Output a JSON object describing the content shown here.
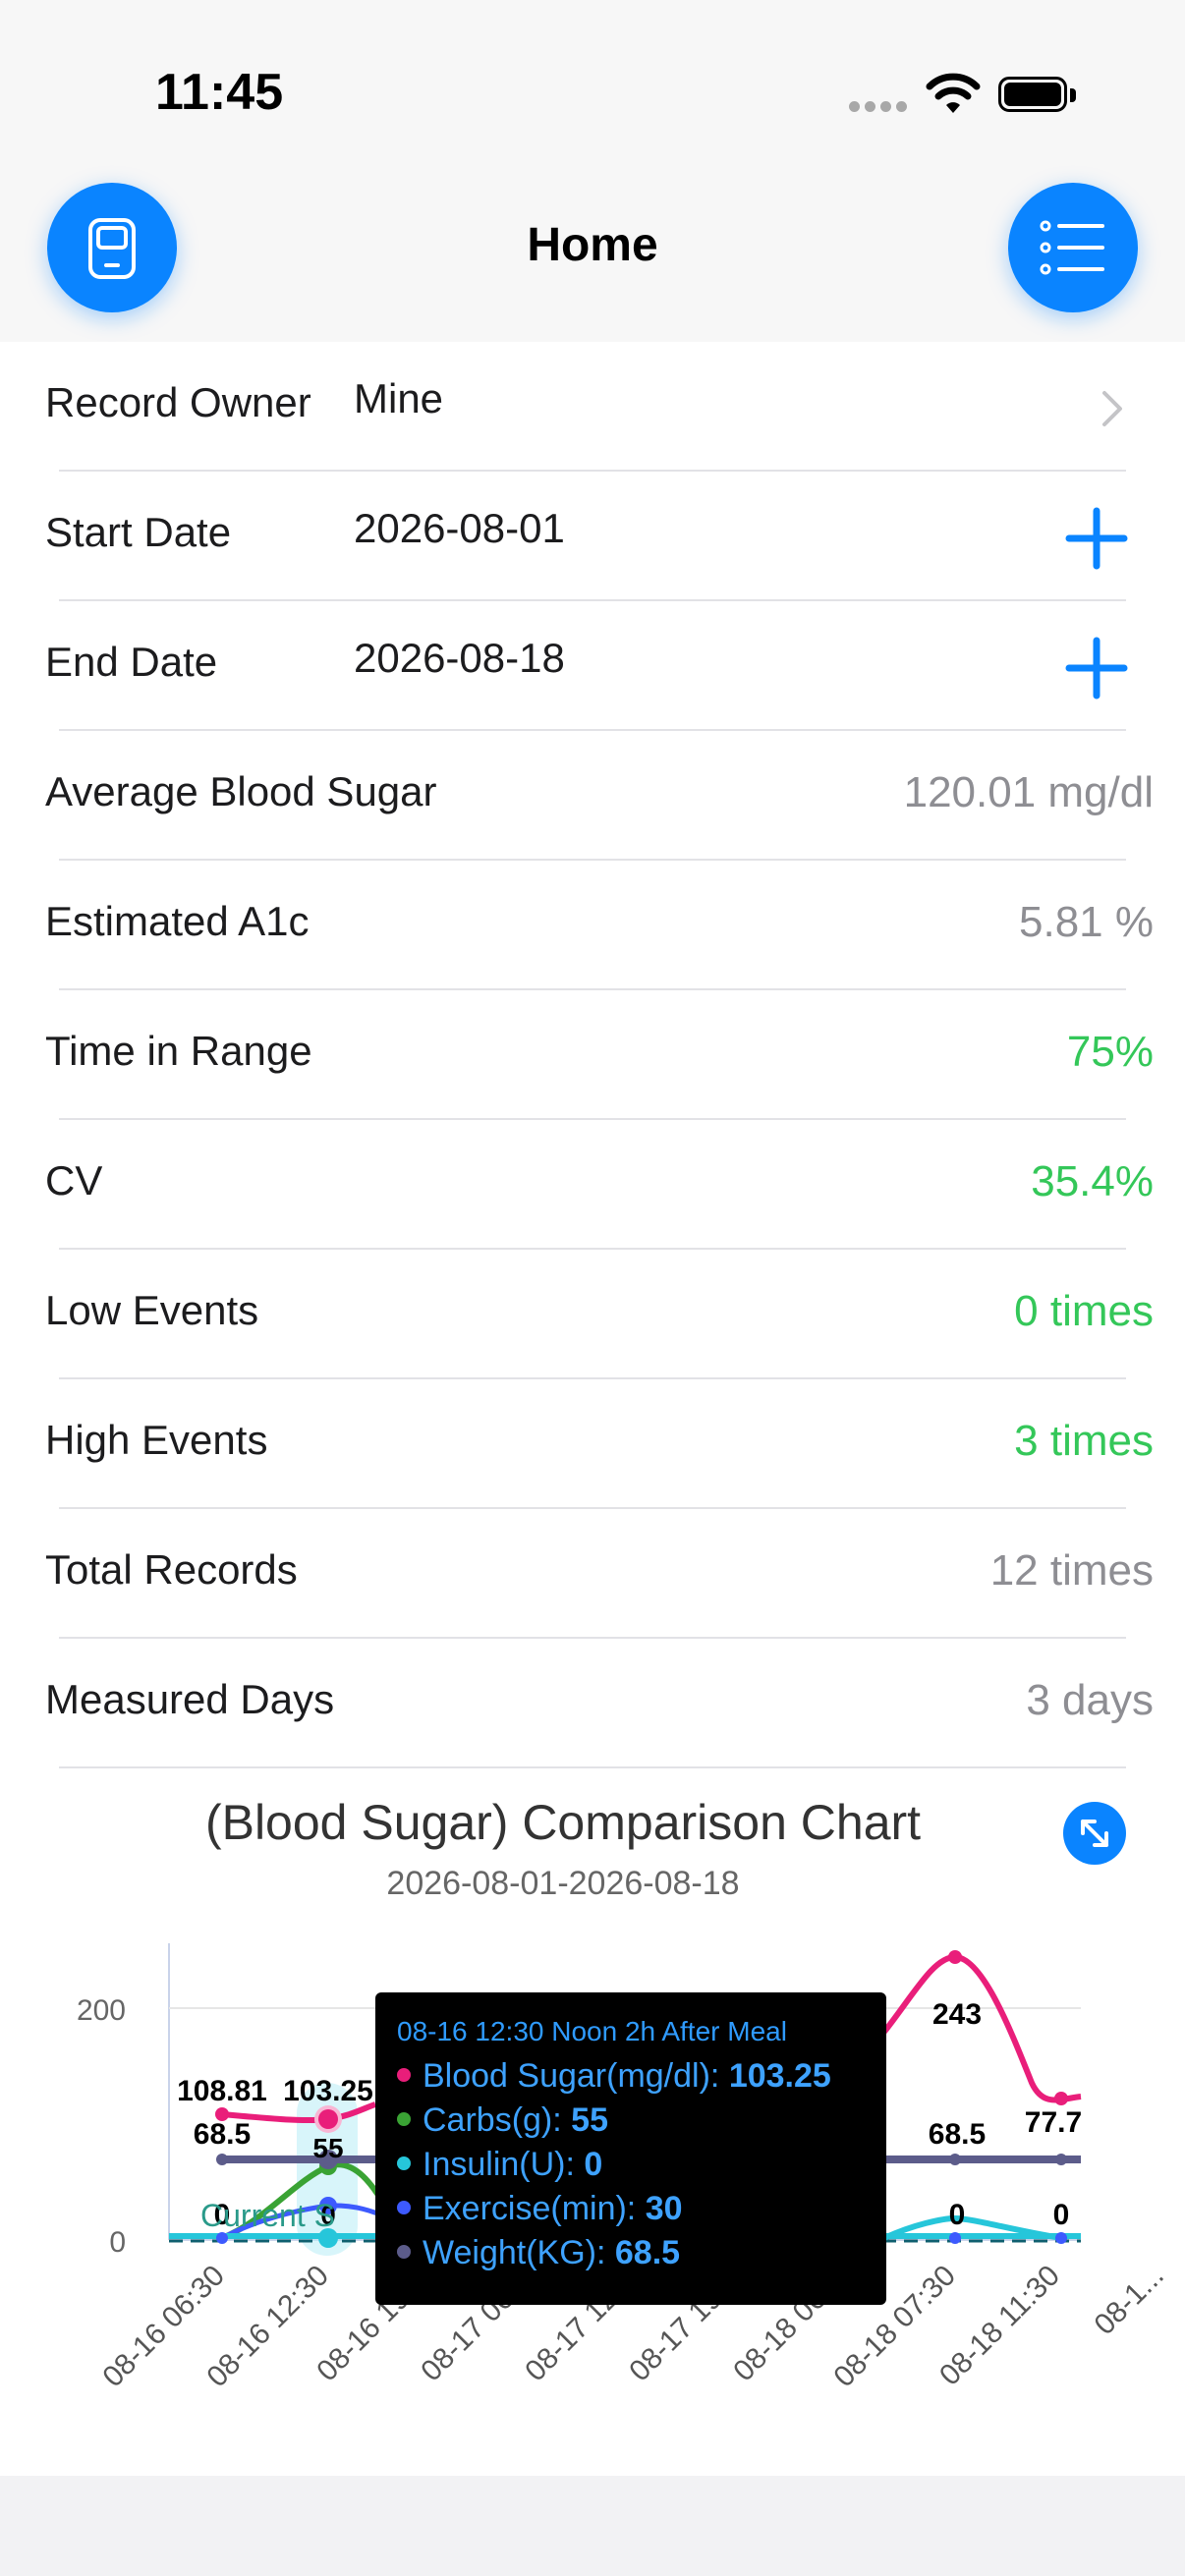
{
  "status": {
    "time": "11:45"
  },
  "nav": {
    "title": "Home",
    "left_icon": "device-icon",
    "right_icon": "list-icon"
  },
  "rows": [
    {
      "label": "Record Owner",
      "value": "Mine"
    },
    {
      "label": "Start Date",
      "value": "2026-08-01"
    },
    {
      "label": "End Date",
      "value": "2026-08-18"
    },
    {
      "label": "Average Blood Sugar",
      "value": "120.01 mg/dl"
    },
    {
      "label": "Estimated A1c",
      "value": "5.81 %"
    },
    {
      "label": "Time in Range",
      "value": "75%"
    },
    {
      "label": "CV",
      "value": "35.4%"
    },
    {
      "label": "Low Events",
      "value": "0 times"
    },
    {
      "label": "High Events",
      "value": "3 times"
    },
    {
      "label": "Total Records",
      "value": "12 times"
    },
    {
      "label": "Measured Days",
      "value": "3 days"
    }
  ],
  "colors": {
    "accent": "#0a84ff",
    "green": "#34c759",
    "gray": "#8e8e93"
  },
  "chart": {
    "title": "(Blood Sugar) Comparison Chart",
    "subtitle": "2026-08-01-2026-08-18",
    "partial_label": "Current S"
  },
  "chart_data": {
    "type": "line",
    "x": [
      "08-16 06:30",
      "08-16 12:30",
      "08-16 19:...",
      "08-17 06:...",
      "08-17 12:...",
      "08-17 19:...",
      "08-18 06:...",
      "08-18 07:30",
      "08-18 11:30",
      "08-1..."
    ],
    "y_ticks": [
      "200",
      "0"
    ],
    "ylim": [
      0,
      240
    ],
    "series": [
      {
        "name": "Blood Sugar(mg/dl)",
        "color": "#e91e7a",
        "labels": [
          "108.81",
          "103.25",
          "243",
          "77.7"
        ]
      },
      {
        "name": "Carbs(g)",
        "color": "#3aa334",
        "labels": [
          "55"
        ]
      },
      {
        "name": "Insulin(U)",
        "color": "#26c6da",
        "labels": [
          "0",
          "0"
        ]
      },
      {
        "name": "Exercise(min)",
        "color": "#3d5afe",
        "labels": [
          "0",
          "0"
        ]
      },
      {
        "name": "Weight(KG)",
        "color": "#5c5c8a",
        "labels": [
          "68.5",
          "68.5"
        ]
      }
    ]
  },
  "tooltip": {
    "header": "08-16 12:30 Noon 2h After Meal",
    "rows": [
      {
        "label": "Blood Sugar(mg/dl):",
        "value": "103.25",
        "color": "#e91e7a"
      },
      {
        "label": "Carbs(g):",
        "value": "55",
        "color": "#3aa334"
      },
      {
        "label": "Insulin(U):",
        "value": "0",
        "color": "#26c6da"
      },
      {
        "label": "Exercise(min):",
        "value": "30",
        "color": "#3d5afe"
      },
      {
        "label": "Weight(KG):",
        "value": "68.5",
        "color": "#5c5c8a"
      }
    ]
  }
}
